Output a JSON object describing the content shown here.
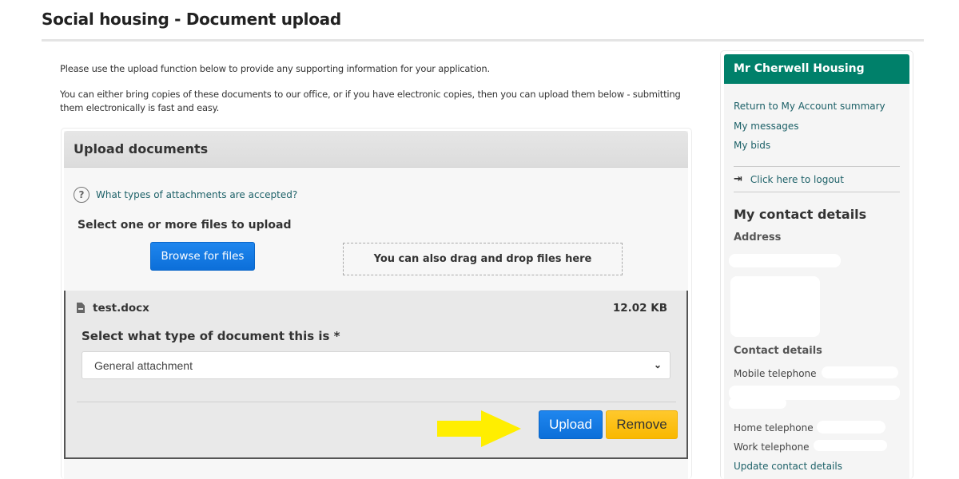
{
  "page": {
    "title": "Social housing - Document upload"
  },
  "intro": {
    "paragraph1": "Please use the upload function below to provide any supporting information for your application.",
    "paragraph2": "You can either bring copies of these documents to our office, or if you have electronic copies, then you can upload them below - submitting them electronically is fast and easy."
  },
  "upload_panel": {
    "title": "Upload documents",
    "help_icon": "question-circle-icon",
    "help_link": "What types of attachments are accepted?",
    "select_files_label": "Select one or more files to upload",
    "browse_button": "Browse for files",
    "drop_zone_text": "You can also drag and drop files here",
    "file": {
      "icon": "file-icon",
      "name": "test.docx",
      "size": "12.02 KB",
      "doc_type_label": "Select what type of document this is *",
      "doc_type_selected": "General attachment",
      "upload_button": "Upload",
      "remove_button": "Remove"
    },
    "annotation": {
      "arrow_color": "#ffee00"
    }
  },
  "sidebar": {
    "header": "Mr Cherwell Housing",
    "links": [
      "Return to My Account summary",
      "My messages",
      "My bids"
    ],
    "logout_icon": "sign-out-icon",
    "logout_link": "Click here to logout",
    "contact_heading": "My contact details",
    "address_label": "Address",
    "contact_details_label": "Contact details",
    "mobile_label": "Mobile telephone",
    "home_label": "Home telephone",
    "work_label": "Work telephone",
    "update_link": "Update contact details"
  },
  "colors": {
    "primary_blue": "#0c6fd9",
    "warning_yellow": "#f9b800",
    "sidebar_header_green": "#00806a",
    "link_teal": "#1d6168"
  }
}
